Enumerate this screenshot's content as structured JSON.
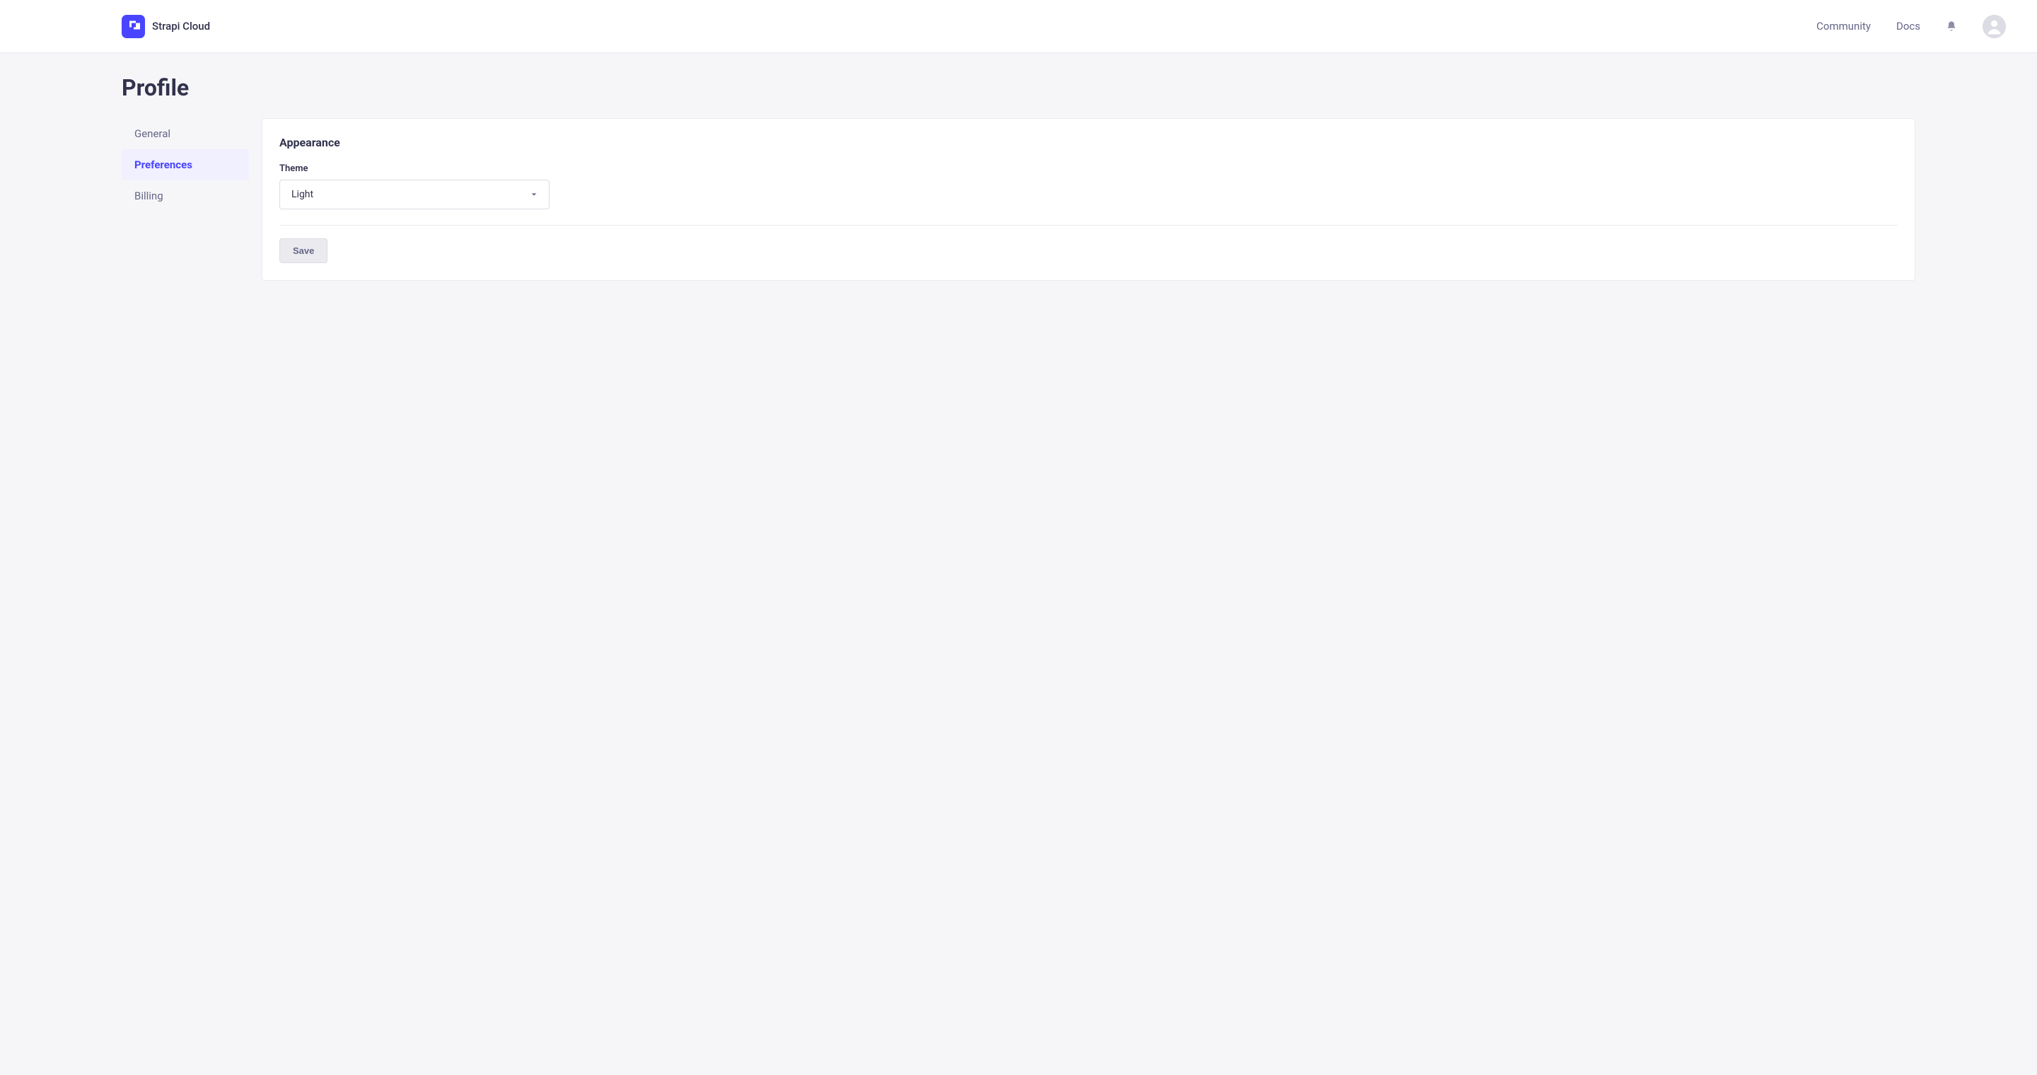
{
  "header": {
    "product_name": "Strapi Cloud",
    "nav": {
      "community": "Community",
      "docs": "Docs"
    }
  },
  "page": {
    "title": "Profile"
  },
  "sidebar": {
    "items": [
      {
        "label": "General",
        "active": false
      },
      {
        "label": "Preferences",
        "active": true
      },
      {
        "label": "Billing",
        "active": false
      }
    ]
  },
  "panel": {
    "section_title": "Appearance",
    "theme": {
      "label": "Theme",
      "value": "Light"
    },
    "save_label": "Save"
  },
  "colors": {
    "primary": "#4945ff",
    "bg": "#f6f6f9",
    "text": "#32324d",
    "muted": "#666687"
  }
}
